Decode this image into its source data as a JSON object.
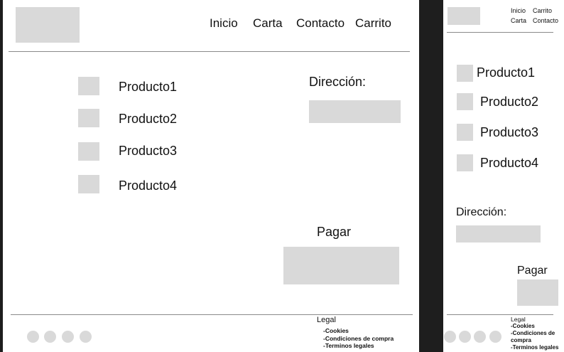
{
  "desktop": {
    "nav": [
      "Inicio",
      "Carta",
      "Contacto",
      "Carrito"
    ],
    "products": [
      "Producto1",
      "Producto2",
      "Producto3",
      "Producto4"
    ],
    "address_label": "Dirección:",
    "pay_label": "Pagar",
    "footer": {
      "legal_title": "Legal",
      "links": [
        "-Cookies",
        "-Condiciones de compra",
        "-Terminos  legales"
      ]
    }
  },
  "mobile": {
    "nav": [
      "Inicio",
      "Carrito",
      "Carta",
      "Contacto"
    ],
    "products": [
      "Producto1",
      "Producto2",
      "Producto3",
      "Producto4"
    ],
    "address_label": "Dirección:",
    "pay_label": "Pagar",
    "footer": {
      "legal_title": "Legal",
      "links": [
        "-Cookies",
        "-Condiciones de",
        "compra",
        "-Terminos  legales"
      ]
    }
  }
}
